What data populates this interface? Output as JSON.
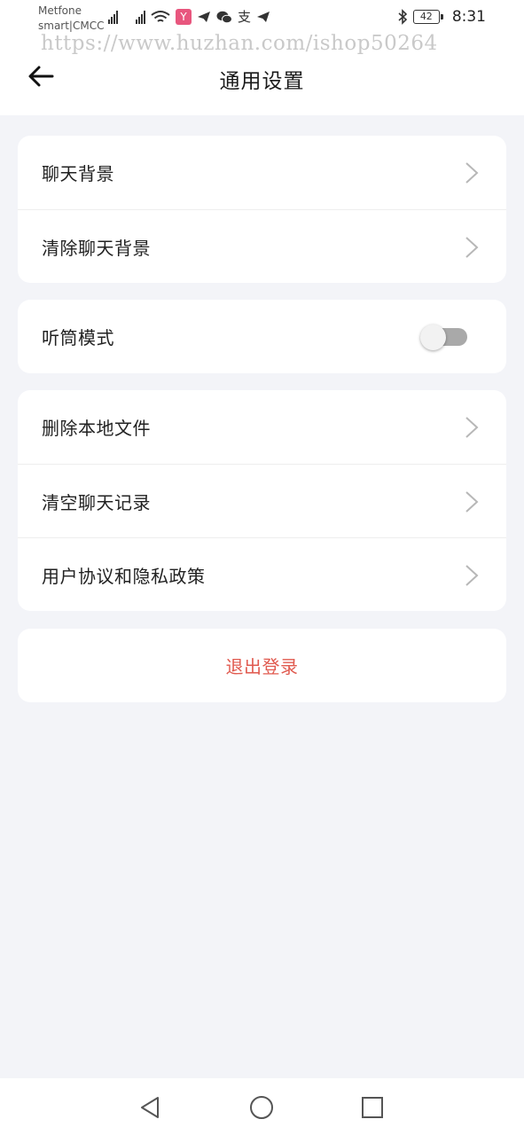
{
  "status_bar": {
    "carrier_line1": "Metfone",
    "carrier_line2": "smart|CMCC",
    "icons": [
      "signal-icon",
      "signal-icon",
      "wifi-icon",
      "app-icon",
      "telegram-icon",
      "wechat-icon",
      "alipay-icon",
      "telegram-icon"
    ],
    "app_badge": "Y",
    "alipay_glyph": "支",
    "battery": "42",
    "time": "8:31"
  },
  "watermark": "https://www.huzhan.com/ishop50264",
  "header": {
    "title": "通用设置",
    "back_icon": "arrow-left-icon"
  },
  "groups": [
    {
      "items": [
        {
          "label": "聊天背景"
        },
        {
          "label": "清除聊天背景"
        }
      ]
    },
    {
      "items": [
        {
          "label": "听筒模式",
          "toggle": false
        }
      ]
    },
    {
      "items": [
        {
          "label": "删除本地文件"
        },
        {
          "label": "清空聊天记录"
        },
        {
          "label": "用户协议和隐私政策"
        }
      ]
    }
  ],
  "logout_label": "退出登录",
  "colors": {
    "background": "#f3f4f8",
    "card": "#ffffff",
    "logout_text": "#e05a4f",
    "toggle_off_track": "#a9a9a9"
  },
  "nav": {
    "icons": [
      "back-triangle-icon",
      "home-circle-icon",
      "recents-square-icon"
    ]
  }
}
